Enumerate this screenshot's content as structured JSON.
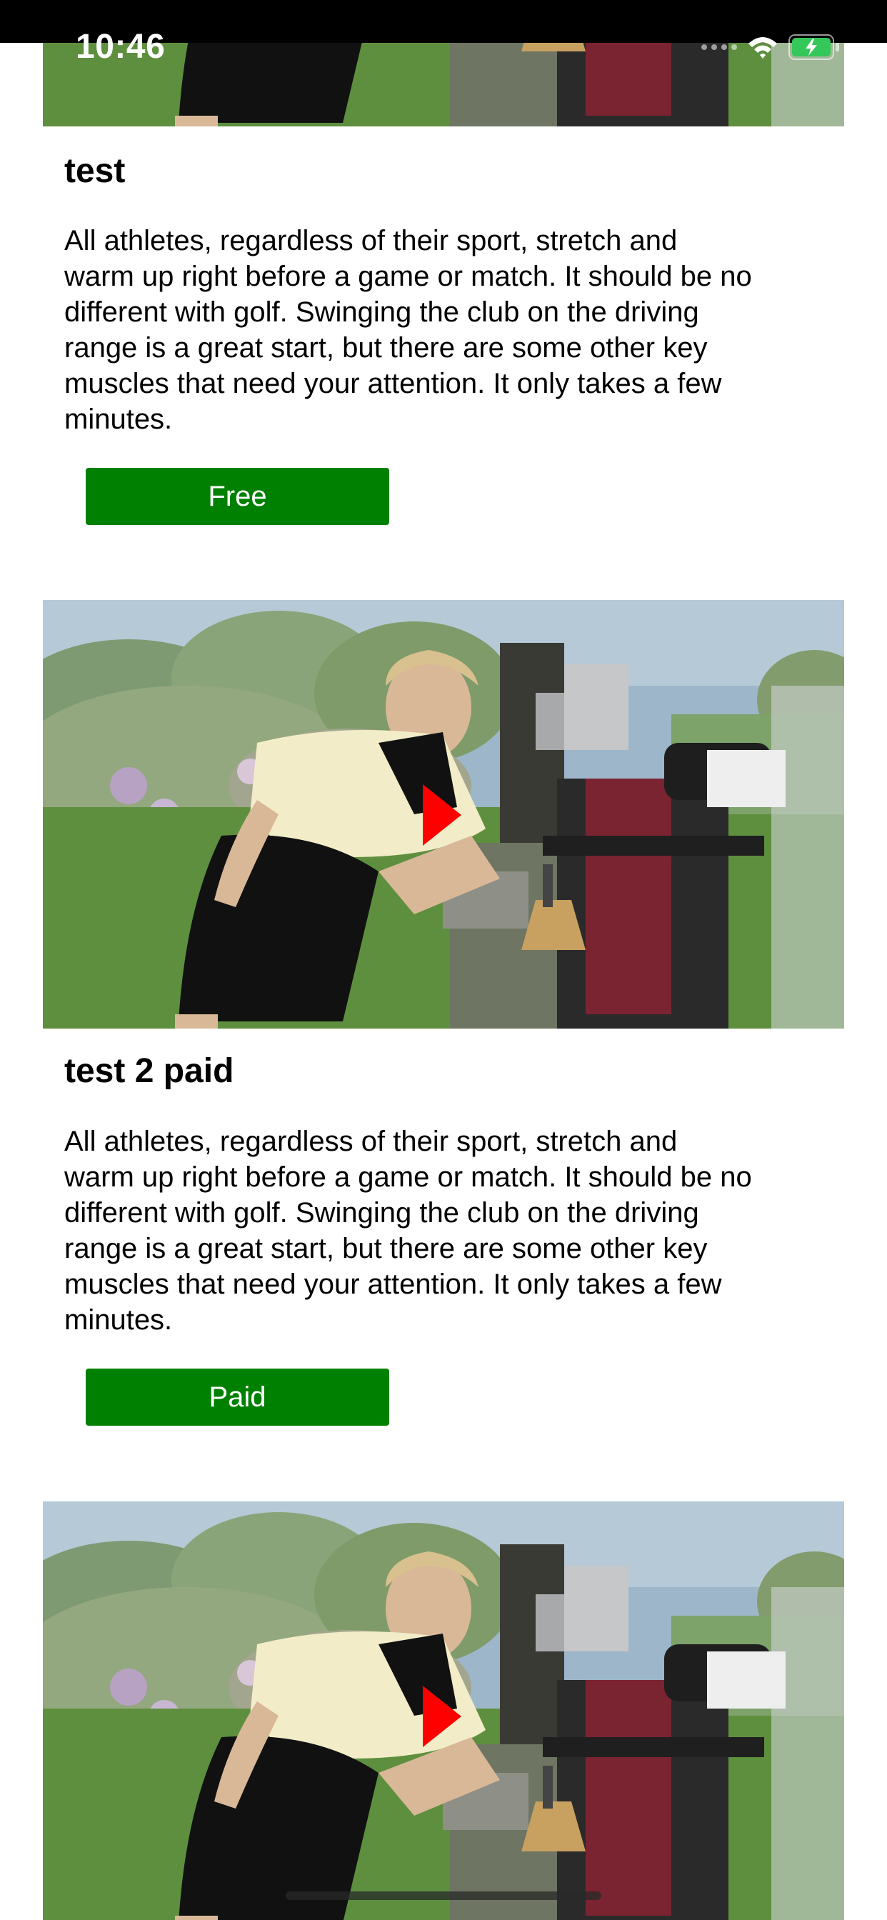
{
  "status_bar": {
    "time": "10:46",
    "icons": [
      "signal-dots",
      "wifi-icon",
      "battery-icon"
    ],
    "battery_color": "#34c759"
  },
  "feed": {
    "items": [
      {
        "title": "test",
        "description_lines": [
          "All athletes, regardless of their sport, stretch and",
          "warm up right before a game or match. It should be no",
          "different with golf. Swinging the club on the driving",
          "range is a great start, but there are some other key",
          "muscles that need your attention. It only takes a few",
          "minutes."
        ],
        "button_label": "Free"
      },
      {
        "title": "test 2 paid",
        "description_lines": [
          "All athletes, regardless of their sport, stretch and",
          "warm up right before a game or match. It should be no",
          "different with golf. Swinging the club on the driving",
          "range is a great start, but there are some other key",
          "muscles that need your attention. It only takes a few",
          "minutes."
        ],
        "button_label": "Paid"
      }
    ]
  },
  "colors": {
    "button_bg": "#008000",
    "button_text": "#ffffff",
    "play_icon": "#ff0000"
  }
}
